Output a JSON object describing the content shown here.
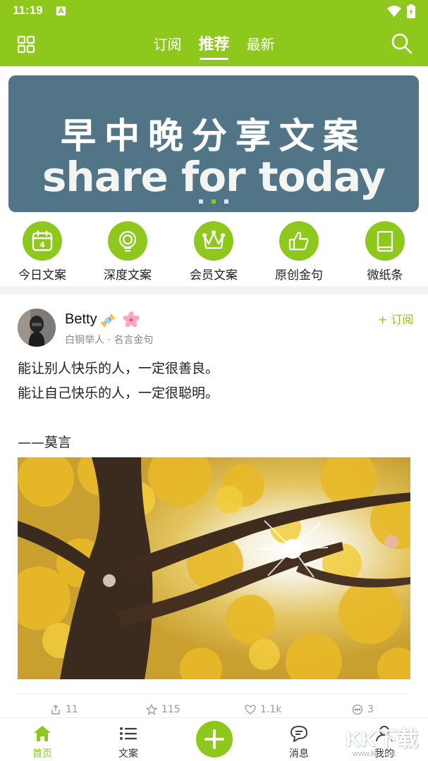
{
  "status_bar": {
    "time": "11:19"
  },
  "header": {
    "tabs": [
      {
        "label": "订阅",
        "active": false
      },
      {
        "label": "推荐",
        "active": true
      },
      {
        "label": "最新",
        "active": false
      }
    ],
    "icons": {
      "left": "grid-icon",
      "right": "search-icon"
    },
    "accent_color": "#8ec81c"
  },
  "banner": {
    "line1": "早中晚分享文案",
    "line2": "share for today",
    "background_color": "#527487",
    "dots": 3,
    "active_dot": 2
  },
  "categories": [
    {
      "label": "今日文案",
      "icon": "calendar-icon",
      "badge": "4"
    },
    {
      "label": "深度文案",
      "icon": "lightbulb-icon"
    },
    {
      "label": "会员文案",
      "icon": "crown-icon"
    },
    {
      "label": "原创金句",
      "icon": "thumbs-up-icon"
    },
    {
      "label": "微纸条",
      "icon": "book-icon"
    }
  ],
  "post": {
    "username": "Betty",
    "badges": [
      "candy-icon",
      "sakura-icon"
    ],
    "meta": "白铜举人 · 名言金句",
    "follow_label": "+ 订阅",
    "lines": [
      "能让别人快乐的人，一定很善良。",
      "能让自己快乐的人，一定很聪明。",
      "",
      "——莫言"
    ],
    "image": "ginkgo-tree-photo",
    "stats": {
      "share": "11",
      "favorite": "115",
      "like": "1.1k",
      "comment": "3"
    }
  },
  "bottom_nav": {
    "items": [
      {
        "label": "首页",
        "icon": "home-icon",
        "active": true
      },
      {
        "label": "文案",
        "icon": "list-icon",
        "active": false
      },
      {
        "label": "消息",
        "icon": "message-icon",
        "active": false
      },
      {
        "label": "我的",
        "icon": "user-icon",
        "active": false
      }
    ],
    "add_icon": "plus-icon"
  },
  "watermark": {
    "text": "KK下载",
    "url": "www.kkx.net"
  }
}
